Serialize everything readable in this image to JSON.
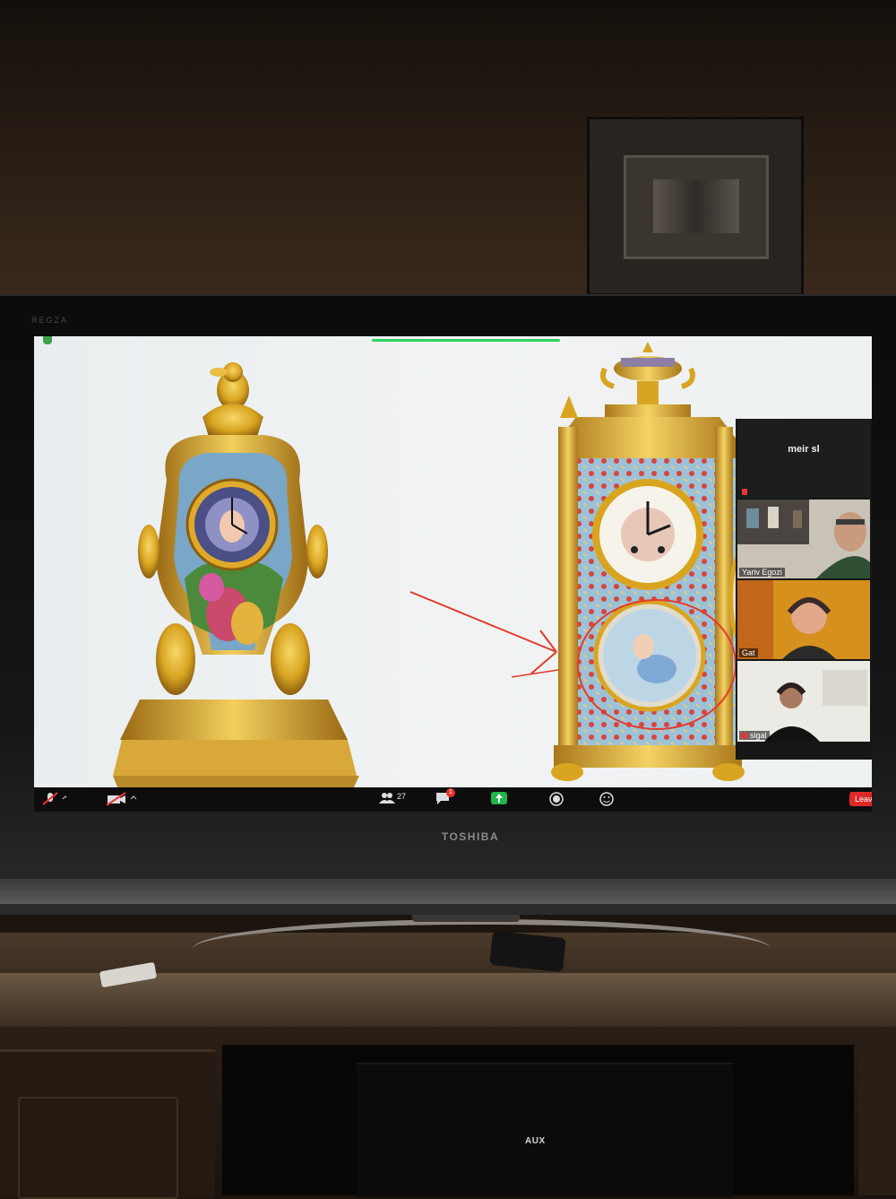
{
  "tv": {
    "brand": "TOSHIBA",
    "top_brand": "REGZA"
  },
  "cabinet": {
    "aux_label": "AUX"
  },
  "participants": [
    {
      "name": "meir sl",
      "muted": true
    },
    {
      "name": "Yariv Egozi",
      "muted": false
    },
    {
      "name": "Gat",
      "muted": false
    },
    {
      "name": "sigal",
      "muted": true
    }
  ],
  "toolbar": {
    "participants_count": "27",
    "chat_badge": "1",
    "leave_label": "Leav"
  },
  "colors": {
    "share_indicator": "#2bd162",
    "leave": "#e02828",
    "annotation": "#e53a2a",
    "gilt": "#d9a521"
  }
}
